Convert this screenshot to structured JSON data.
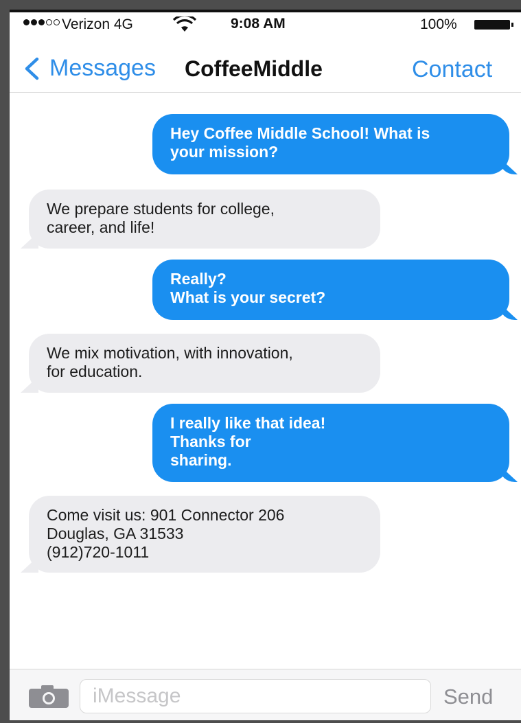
{
  "status_bar": {
    "carrier": "Verizon 4G",
    "time": "9:08 AM",
    "battery_percent": "100%",
    "signal_bars_filled": 3,
    "signal_bars_total": 5,
    "icons": [
      "signal-dots-icon",
      "wifi-icon",
      "battery-icon"
    ]
  },
  "nav": {
    "back_label": "Messages",
    "title": "CoffeeMiddle",
    "contact_label": "Contact",
    "icons": [
      "chevron-left-icon"
    ]
  },
  "messages": [
    {
      "direction": "outgoing",
      "text": "Hey Coffee Middle School! What is\nyour mission?"
    },
    {
      "direction": "incoming",
      "text": "We prepare students for college,\ncareer, and life!"
    },
    {
      "direction": "outgoing",
      "text": "Really?\nWhat is your secret?"
    },
    {
      "direction": "incoming",
      "text": "We mix motivation, with innovation,\nfor education."
    },
    {
      "direction": "outgoing",
      "text": "I really like that idea!\nThanks for\nsharing."
    },
    {
      "direction": "incoming",
      "text": "Come visit us: 901 Connector 206\nDouglas, GA 31533\n(912)720-1011"
    }
  ],
  "input_bar": {
    "placeholder": "iMessage",
    "value": "",
    "send_label": "Send",
    "icons": [
      "camera-icon"
    ]
  },
  "colors": {
    "accent": "#2f8ee8",
    "outgoing_bubble": "#1a8ff0",
    "incoming_bubble": "#ececef"
  }
}
